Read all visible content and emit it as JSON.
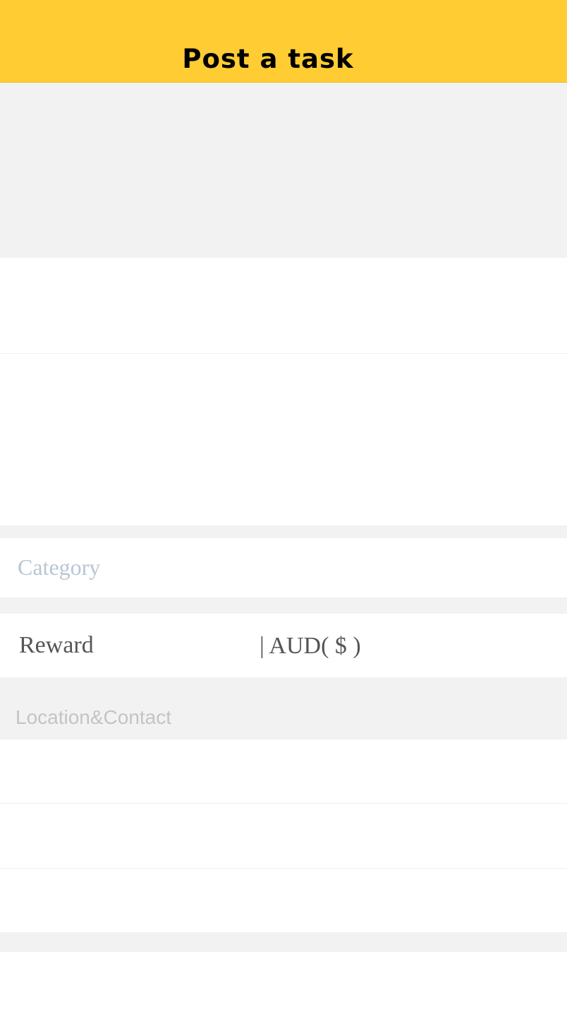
{
  "header": {
    "title": "Post a task"
  },
  "form": {
    "category": {
      "placeholder": "Category"
    },
    "reward": {
      "label": "Reward",
      "placeholder": "| AUD( $ )"
    },
    "location_section": {
      "label": "Location&Contact"
    }
  },
  "colors": {
    "header_background": "#ffcc33",
    "page_background": "#f2f2f2",
    "row_background": "#ffffff",
    "placeholder_text": "#b9c6d4",
    "label_text": "#555555"
  }
}
